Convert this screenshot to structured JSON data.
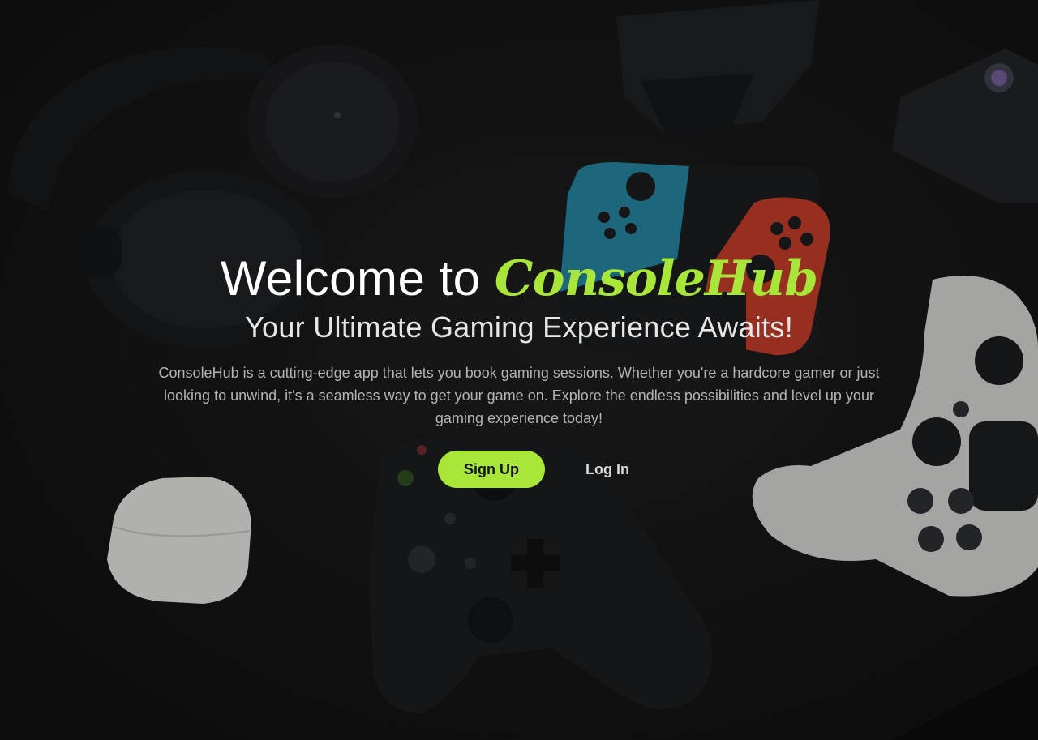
{
  "hero": {
    "title_prefix": "Welcome to",
    "brand": "ConsoleHub",
    "subtitle": "Your Ultimate Gaming Experience Awaits!",
    "description": "ConsoleHub is a cutting-edge app that lets you book gaming sessions. Whether you're a hardcore gamer or just looking to unwind, it's a seamless way to get your game on. Explore the endless possibilities and level up your gaming experience today!"
  },
  "actions": {
    "signup_label": "Sign Up",
    "login_label": "Log In"
  },
  "colors": {
    "accent": "#a8e63a",
    "background": "#131313",
    "text_primary": "#ffffff",
    "text_secondary": "#b4b4b4",
    "switch_left_joycon": "#2a9fbf",
    "switch_right_joycon": "#d9442c"
  },
  "background_image_items": [
    "headphones-icon",
    "nintendo-switch-icon",
    "ps4-controller-icon",
    "xbox-controller-icon",
    "airpods-case-icon",
    "speaker-icon"
  ]
}
